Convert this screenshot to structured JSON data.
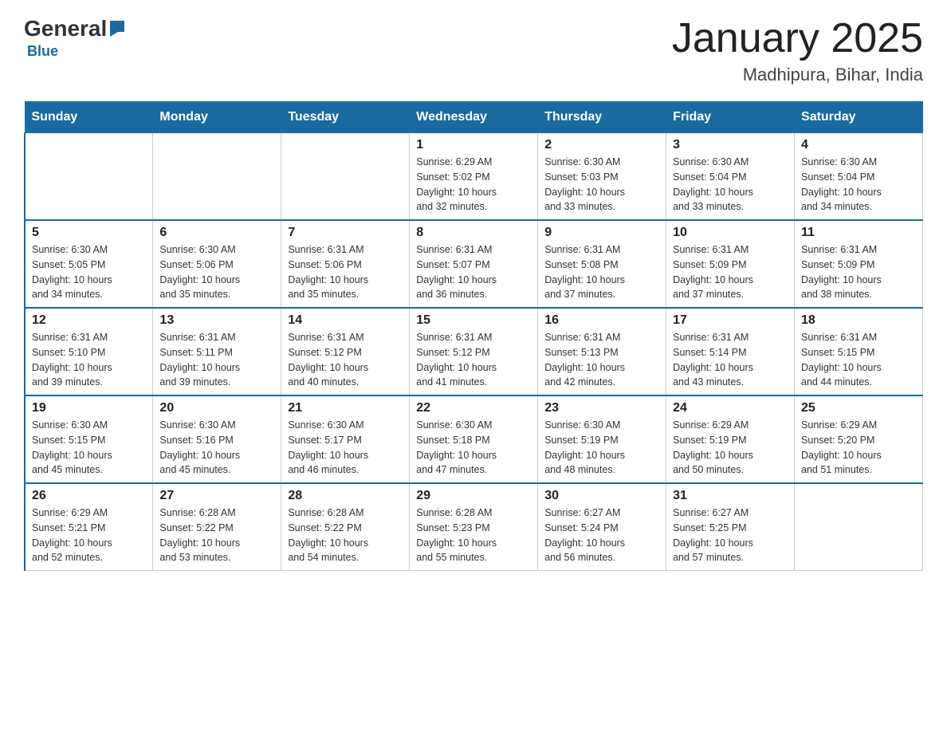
{
  "header": {
    "logo_general": "General",
    "logo_blue": "Blue",
    "month_title": "January 2025",
    "location": "Madhipura, Bihar, India"
  },
  "days_of_week": [
    "Sunday",
    "Monday",
    "Tuesday",
    "Wednesday",
    "Thursday",
    "Friday",
    "Saturday"
  ],
  "weeks": [
    [
      {
        "day": "",
        "sunrise": "",
        "sunset": "",
        "daylight": ""
      },
      {
        "day": "",
        "sunrise": "",
        "sunset": "",
        "daylight": ""
      },
      {
        "day": "",
        "sunrise": "",
        "sunset": "",
        "daylight": ""
      },
      {
        "day": "1",
        "sunrise": "Sunrise: 6:29 AM",
        "sunset": "Sunset: 5:02 PM",
        "daylight": "Daylight: 10 hours and 32 minutes."
      },
      {
        "day": "2",
        "sunrise": "Sunrise: 6:30 AM",
        "sunset": "Sunset: 5:03 PM",
        "daylight": "Daylight: 10 hours and 33 minutes."
      },
      {
        "day": "3",
        "sunrise": "Sunrise: 6:30 AM",
        "sunset": "Sunset: 5:04 PM",
        "daylight": "Daylight: 10 hours and 33 minutes."
      },
      {
        "day": "4",
        "sunrise": "Sunrise: 6:30 AM",
        "sunset": "Sunset: 5:04 PM",
        "daylight": "Daylight: 10 hours and 34 minutes."
      }
    ],
    [
      {
        "day": "5",
        "sunrise": "Sunrise: 6:30 AM",
        "sunset": "Sunset: 5:05 PM",
        "daylight": "Daylight: 10 hours and 34 minutes."
      },
      {
        "day": "6",
        "sunrise": "Sunrise: 6:30 AM",
        "sunset": "Sunset: 5:06 PM",
        "daylight": "Daylight: 10 hours and 35 minutes."
      },
      {
        "day": "7",
        "sunrise": "Sunrise: 6:31 AM",
        "sunset": "Sunset: 5:06 PM",
        "daylight": "Daylight: 10 hours and 35 minutes."
      },
      {
        "day": "8",
        "sunrise": "Sunrise: 6:31 AM",
        "sunset": "Sunset: 5:07 PM",
        "daylight": "Daylight: 10 hours and 36 minutes."
      },
      {
        "day": "9",
        "sunrise": "Sunrise: 6:31 AM",
        "sunset": "Sunset: 5:08 PM",
        "daylight": "Daylight: 10 hours and 37 minutes."
      },
      {
        "day": "10",
        "sunrise": "Sunrise: 6:31 AM",
        "sunset": "Sunset: 5:09 PM",
        "daylight": "Daylight: 10 hours and 37 minutes."
      },
      {
        "day": "11",
        "sunrise": "Sunrise: 6:31 AM",
        "sunset": "Sunset: 5:09 PM",
        "daylight": "Daylight: 10 hours and 38 minutes."
      }
    ],
    [
      {
        "day": "12",
        "sunrise": "Sunrise: 6:31 AM",
        "sunset": "Sunset: 5:10 PM",
        "daylight": "Daylight: 10 hours and 39 minutes."
      },
      {
        "day": "13",
        "sunrise": "Sunrise: 6:31 AM",
        "sunset": "Sunset: 5:11 PM",
        "daylight": "Daylight: 10 hours and 39 minutes."
      },
      {
        "day": "14",
        "sunrise": "Sunrise: 6:31 AM",
        "sunset": "Sunset: 5:12 PM",
        "daylight": "Daylight: 10 hours and 40 minutes."
      },
      {
        "day": "15",
        "sunrise": "Sunrise: 6:31 AM",
        "sunset": "Sunset: 5:12 PM",
        "daylight": "Daylight: 10 hours and 41 minutes."
      },
      {
        "day": "16",
        "sunrise": "Sunrise: 6:31 AM",
        "sunset": "Sunset: 5:13 PM",
        "daylight": "Daylight: 10 hours and 42 minutes."
      },
      {
        "day": "17",
        "sunrise": "Sunrise: 6:31 AM",
        "sunset": "Sunset: 5:14 PM",
        "daylight": "Daylight: 10 hours and 43 minutes."
      },
      {
        "day": "18",
        "sunrise": "Sunrise: 6:31 AM",
        "sunset": "Sunset: 5:15 PM",
        "daylight": "Daylight: 10 hours and 44 minutes."
      }
    ],
    [
      {
        "day": "19",
        "sunrise": "Sunrise: 6:30 AM",
        "sunset": "Sunset: 5:15 PM",
        "daylight": "Daylight: 10 hours and 45 minutes."
      },
      {
        "day": "20",
        "sunrise": "Sunrise: 6:30 AM",
        "sunset": "Sunset: 5:16 PM",
        "daylight": "Daylight: 10 hours and 45 minutes."
      },
      {
        "day": "21",
        "sunrise": "Sunrise: 6:30 AM",
        "sunset": "Sunset: 5:17 PM",
        "daylight": "Daylight: 10 hours and 46 minutes."
      },
      {
        "day": "22",
        "sunrise": "Sunrise: 6:30 AM",
        "sunset": "Sunset: 5:18 PM",
        "daylight": "Daylight: 10 hours and 47 minutes."
      },
      {
        "day": "23",
        "sunrise": "Sunrise: 6:30 AM",
        "sunset": "Sunset: 5:19 PM",
        "daylight": "Daylight: 10 hours and 48 minutes."
      },
      {
        "day": "24",
        "sunrise": "Sunrise: 6:29 AM",
        "sunset": "Sunset: 5:19 PM",
        "daylight": "Daylight: 10 hours and 50 minutes."
      },
      {
        "day": "25",
        "sunrise": "Sunrise: 6:29 AM",
        "sunset": "Sunset: 5:20 PM",
        "daylight": "Daylight: 10 hours and 51 minutes."
      }
    ],
    [
      {
        "day": "26",
        "sunrise": "Sunrise: 6:29 AM",
        "sunset": "Sunset: 5:21 PM",
        "daylight": "Daylight: 10 hours and 52 minutes."
      },
      {
        "day": "27",
        "sunrise": "Sunrise: 6:28 AM",
        "sunset": "Sunset: 5:22 PM",
        "daylight": "Daylight: 10 hours and 53 minutes."
      },
      {
        "day": "28",
        "sunrise": "Sunrise: 6:28 AM",
        "sunset": "Sunset: 5:22 PM",
        "daylight": "Daylight: 10 hours and 54 minutes."
      },
      {
        "day": "29",
        "sunrise": "Sunrise: 6:28 AM",
        "sunset": "Sunset: 5:23 PM",
        "daylight": "Daylight: 10 hours and 55 minutes."
      },
      {
        "day": "30",
        "sunrise": "Sunrise: 6:27 AM",
        "sunset": "Sunset: 5:24 PM",
        "daylight": "Daylight: 10 hours and 56 minutes."
      },
      {
        "day": "31",
        "sunrise": "Sunrise: 6:27 AM",
        "sunset": "Sunset: 5:25 PM",
        "daylight": "Daylight: 10 hours and 57 minutes."
      },
      {
        "day": "",
        "sunrise": "",
        "sunset": "",
        "daylight": ""
      }
    ]
  ]
}
